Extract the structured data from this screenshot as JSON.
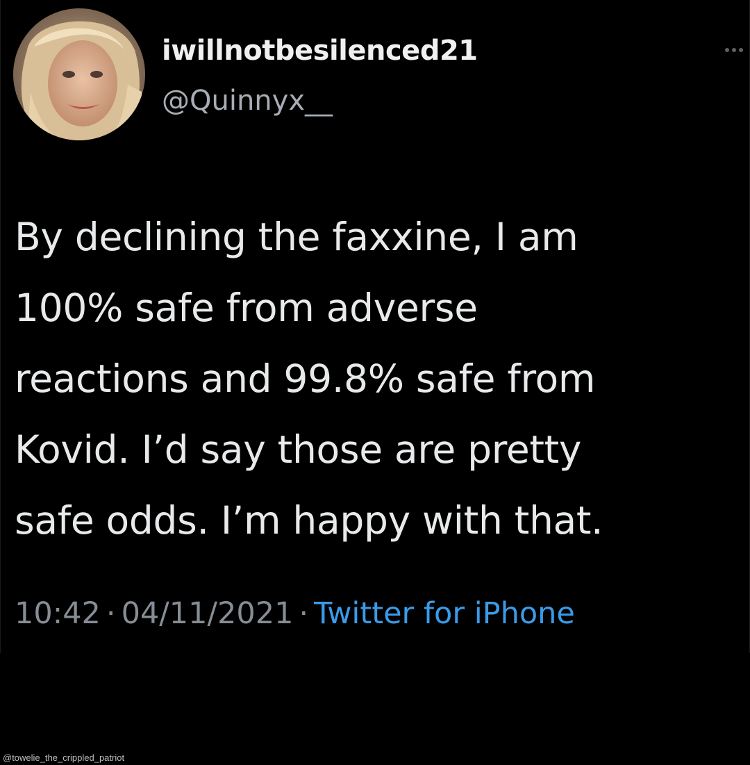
{
  "tweet": {
    "display_name": "iwillnotbesilenced21",
    "handle": "@Quinnyx__",
    "text_lines": [
      "By declining the faxxine, I am",
      "100% safe from adverse",
      "reactions and 99.8% safe from",
      "Kovid. I’d say those are pretty",
      "safe odds. I’m happy with that."
    ],
    "time": "10:42",
    "date": "04/11/2021",
    "separator": "·",
    "source": "Twitter for iPhone"
  },
  "icons": {
    "avatar": "profile-photo",
    "more": "more-options-icon"
  },
  "colors": {
    "background": "#000000",
    "text": "#e7e9ea",
    "secondary_text": "#868d94",
    "link": "#3b9be8"
  },
  "watermark": "@towelie_the_crippled_patriot"
}
